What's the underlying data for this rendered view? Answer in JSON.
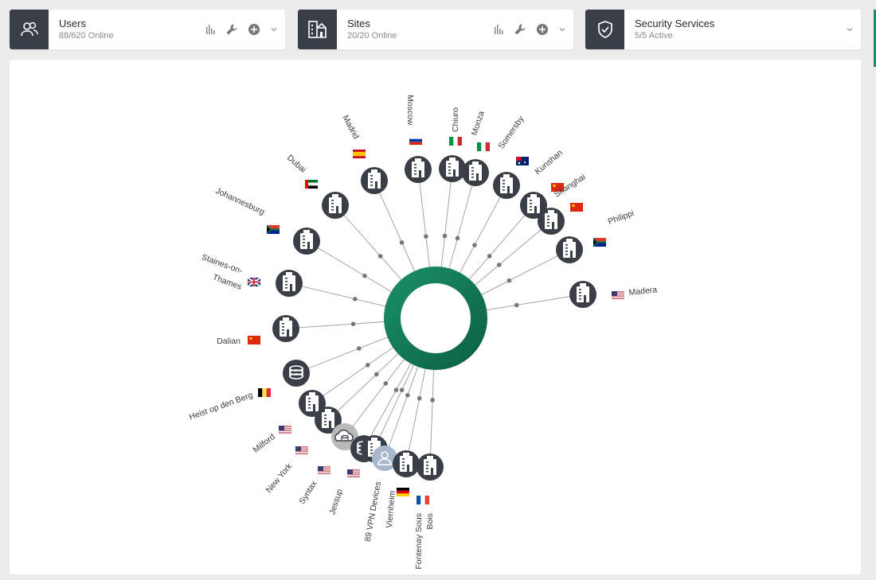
{
  "cards": {
    "users": {
      "title": "Users",
      "sub": "88/620 Online"
    },
    "sites": {
      "title": "Sites",
      "sub": "20/20 Online"
    },
    "security": {
      "title": "Security Services",
      "sub": "5/5 Active"
    }
  },
  "icons": {
    "users": "users-icon",
    "sites": "buildings-icon",
    "security": "shield-icon",
    "stats": "bar-chart-icon",
    "tools": "wrench-icon",
    "add": "plus-circle-icon",
    "expand": "chevron-down-icon"
  },
  "colors": {
    "dark": "#3a3f47",
    "accent": "#1a8a66",
    "hub_outer": "#0f7a58",
    "hub_inner": "#0a5e43"
  },
  "nodes": [
    {
      "label": "Moscow",
      "type": "site",
      "flag": "ru"
    },
    {
      "label": "Chiuro",
      "type": "site",
      "flag": "it"
    },
    {
      "label": "Monza",
      "type": "site",
      "flag": "it"
    },
    {
      "label": "Somersby",
      "type": "site",
      "flag": "au"
    },
    {
      "label": "Kunshan",
      "type": "site",
      "flag": "cn"
    },
    {
      "label": "Shanghai",
      "type": "site",
      "flag": "cn"
    },
    {
      "label": "Philippi",
      "type": "site",
      "flag": "za"
    },
    {
      "label": "Madera",
      "type": "site",
      "flag": "us"
    },
    {
      "label": "Madrid",
      "type": "site",
      "flag": "es"
    },
    {
      "label": "Dubai",
      "type": "site",
      "flag": "ae"
    },
    {
      "label": "Johannesburg",
      "type": "site",
      "flag": "za"
    },
    {
      "label": "Staines-on-",
      "label2": "Thames",
      "type": "site",
      "flag": "gb"
    },
    {
      "label": "Dalian",
      "type": "site",
      "flag": "cn"
    },
    {
      "label": "",
      "type": "database",
      "flag": ""
    },
    {
      "label": "Heist op den Berg",
      "type": "site",
      "flag": "be"
    },
    {
      "label": "Milford",
      "type": "site",
      "flag": "us"
    },
    {
      "label": "New York",
      "type": "cloud",
      "flag": "us"
    },
    {
      "label": "Syntax",
      "type": "database",
      "flag": "us"
    },
    {
      "label": "Jessup",
      "type": "site",
      "flag": "us"
    },
    {
      "label": "89 VPN Devices",
      "type": "user",
      "flag": ""
    },
    {
      "label": "Viernheim",
      "type": "site",
      "flag": "de"
    },
    {
      "label": "Fontenay Sous",
      "label2": "Bois",
      "type": "site",
      "flag": "fr"
    }
  ]
}
